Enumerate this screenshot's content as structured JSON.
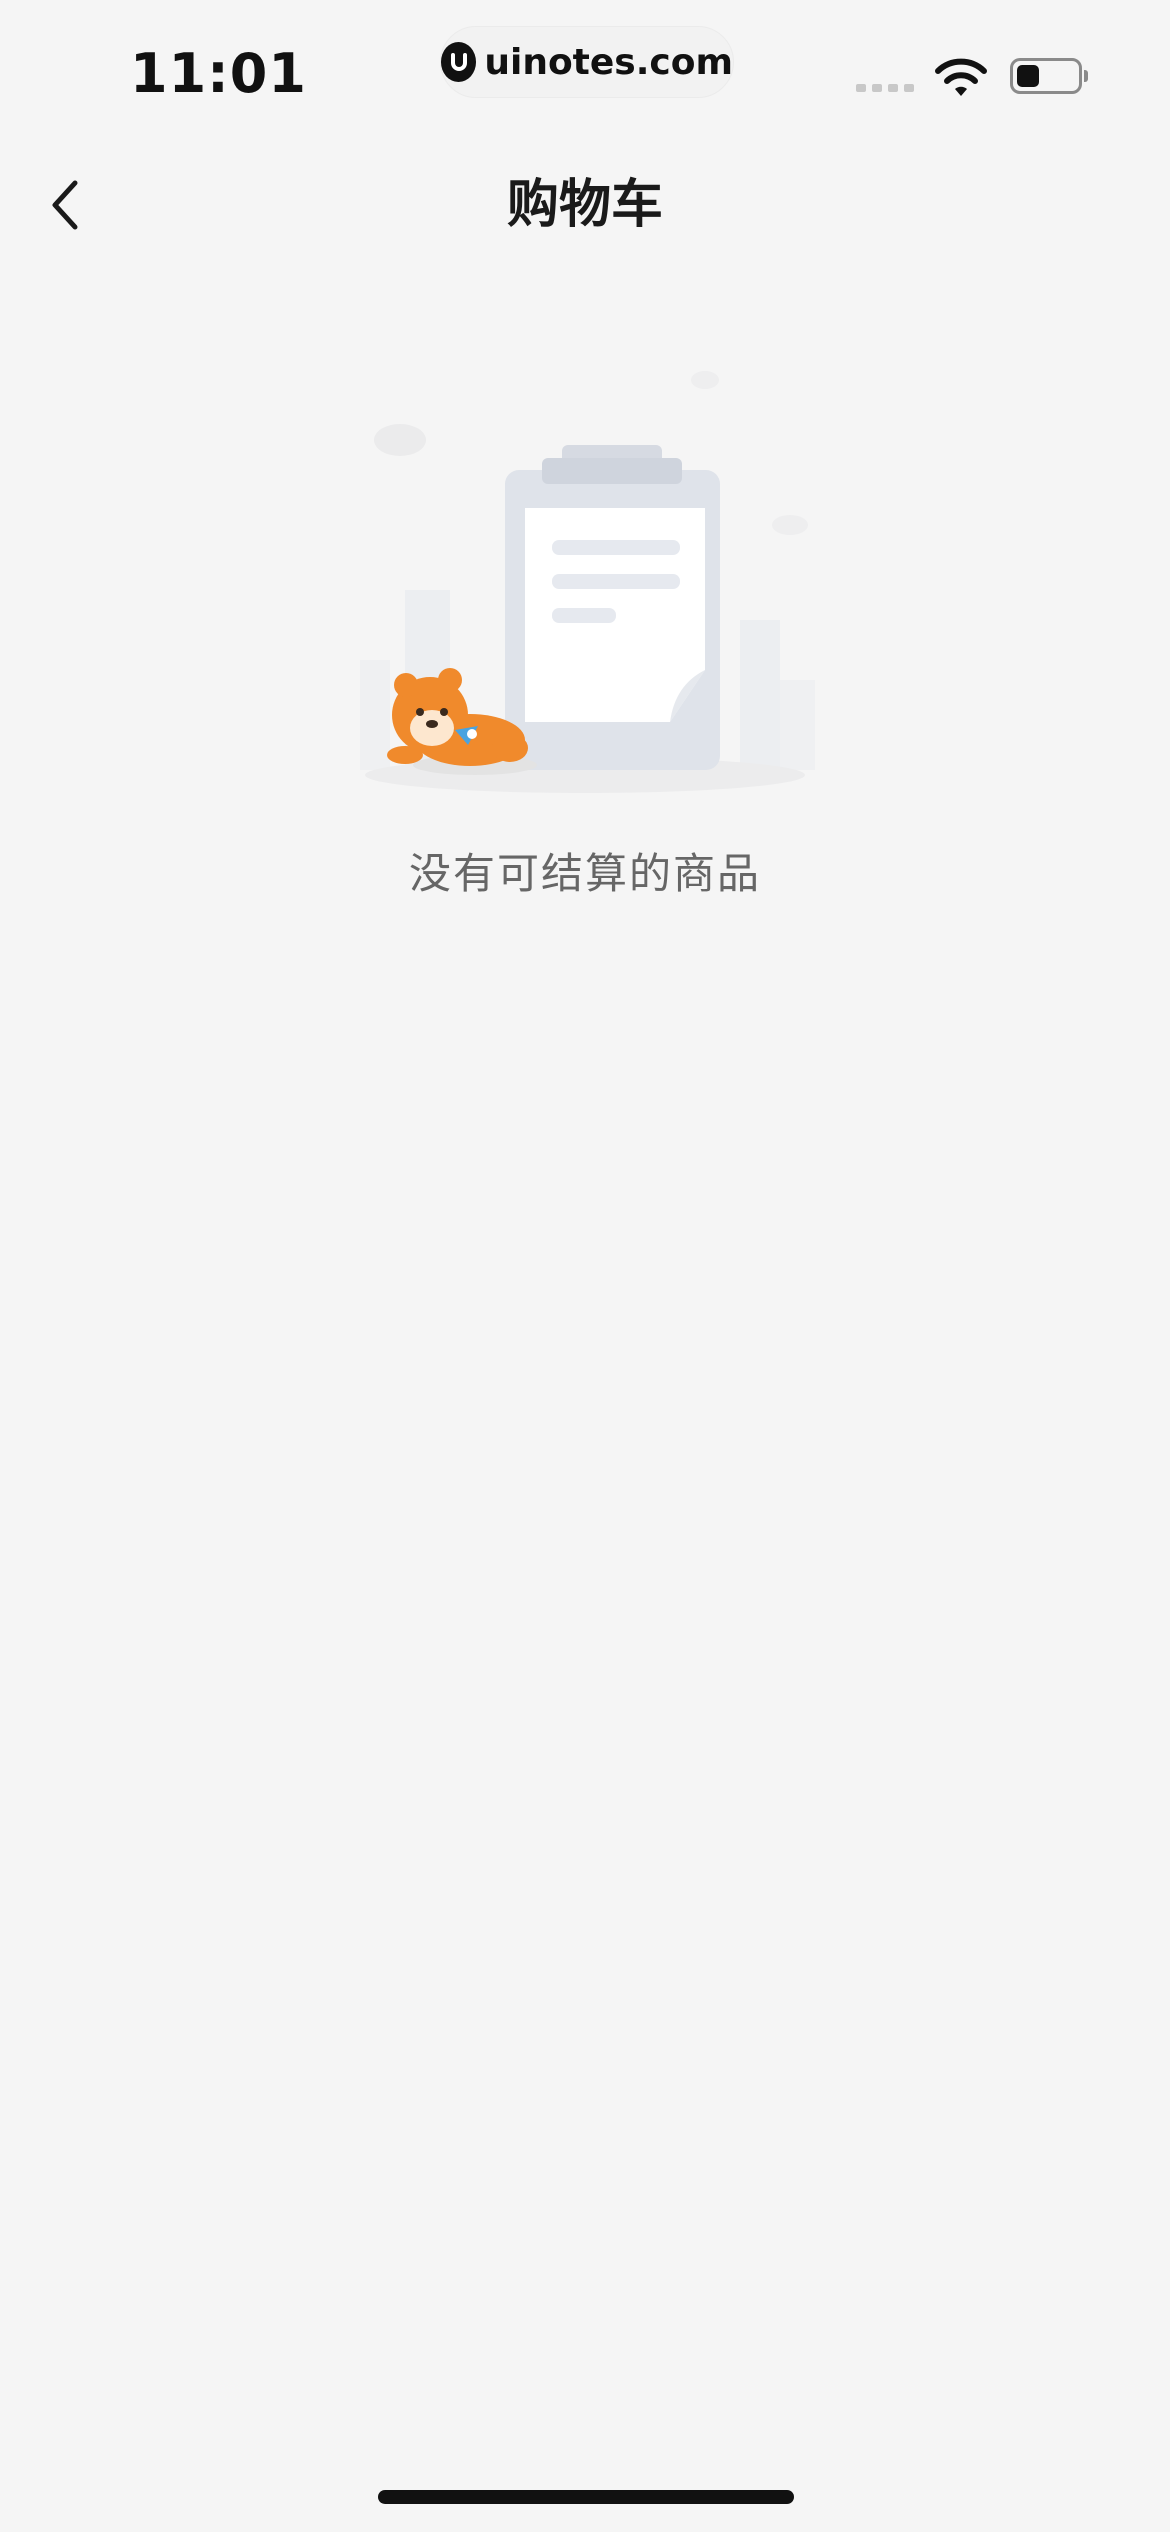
{
  "status_bar": {
    "time": "11:01",
    "watermark": "uinotes.com"
  },
  "nav": {
    "title": "购物车",
    "back_icon": "chevron-left-icon"
  },
  "empty_state": {
    "message": "没有可结算的商品",
    "illustration": "empty-clipboard-with-mascot"
  },
  "colors": {
    "background": "#f5f5f5",
    "title": "#1a1a1a",
    "message": "#666666",
    "mascot": "#f08a2c"
  }
}
